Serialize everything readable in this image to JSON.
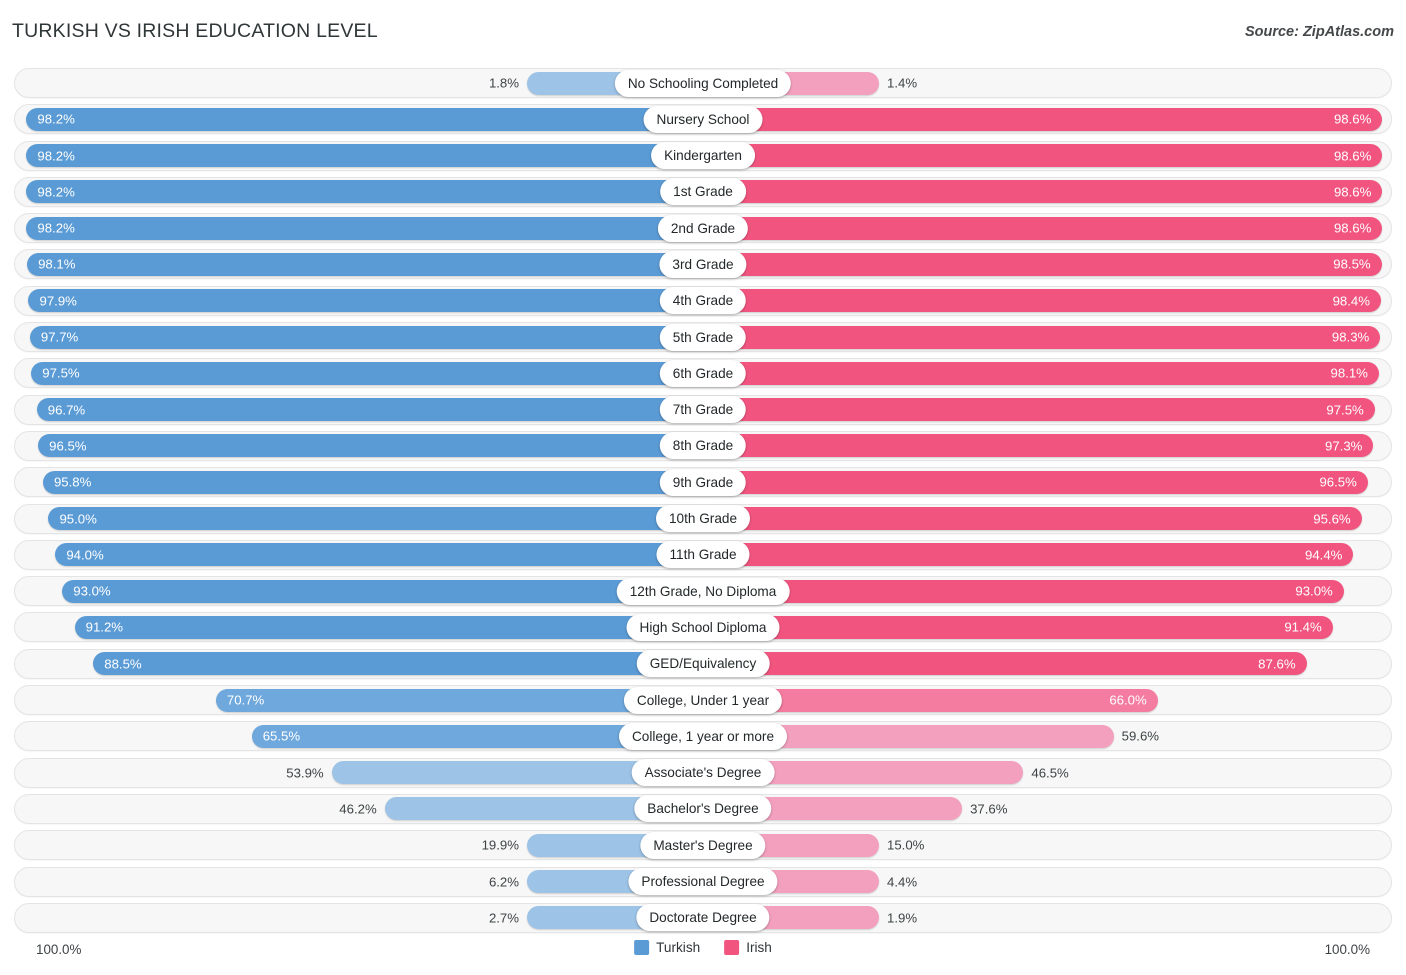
{
  "header": {
    "title": "TURKISH VS IRISH EDUCATION LEVEL",
    "source": "Source: ZipAtlas.com"
  },
  "footer": {
    "axis_left": "100.0%",
    "axis_right": "100.0%"
  },
  "legend": {
    "items": [
      {
        "label": "Turkish",
        "color": "#5B9BD5",
        "icon": "legend-swatch-turkish"
      },
      {
        "label": "Irish",
        "color": "#F1557F",
        "icon": "legend-swatch-irish"
      }
    ]
  },
  "colors": {
    "turkish_dark": "#5B9BD5",
    "turkish_mid": "#6FA8DC",
    "turkish_light": "#9DC3E6",
    "irish_dark": "#F1557F",
    "irish_mid": "#F47CA0",
    "irish_light": "#F2A0BE",
    "track": "#F7F7F7",
    "track_border": "#E4E4E4"
  },
  "chart_data": {
    "type": "bar",
    "orientation": "horizontal",
    "style": "diverging-bidirectional",
    "title": "TURKISH VS IRISH EDUCATION LEVEL",
    "xlabel": "",
    "ylabel": "",
    "xlim": [
      0,
      100
    ],
    "axis_left_max": "100.0%",
    "axis_right_max": "100.0%",
    "grid": false,
    "legend_position": "bottom-center",
    "categories": [
      "No Schooling Completed",
      "Nursery School",
      "Kindergarten",
      "1st Grade",
      "2nd Grade",
      "3rd Grade",
      "4th Grade",
      "5th Grade",
      "6th Grade",
      "7th Grade",
      "8th Grade",
      "9th Grade",
      "10th Grade",
      "11th Grade",
      "12th Grade, No Diploma",
      "High School Diploma",
      "GED/Equivalency",
      "College, Under 1 year",
      "College, 1 year or more",
      "Associate's Degree",
      "Bachelor's Degree",
      "Master's Degree",
      "Professional Degree",
      "Doctorate Degree"
    ],
    "series": [
      {
        "name": "Turkish",
        "side": "left",
        "color": "#5B9BD5",
        "values": [
          1.8,
          98.2,
          98.2,
          98.2,
          98.2,
          98.1,
          97.9,
          97.7,
          97.5,
          96.7,
          96.5,
          95.8,
          95.0,
          94.0,
          93.0,
          91.2,
          88.5,
          70.7,
          65.5,
          53.9,
          46.2,
          19.9,
          6.2,
          2.7
        ],
        "labels": [
          "1.8%",
          "98.2%",
          "98.2%",
          "98.2%",
          "98.2%",
          "98.1%",
          "97.9%",
          "97.7%",
          "97.5%",
          "96.7%",
          "96.5%",
          "95.8%",
          "95.0%",
          "94.0%",
          "93.0%",
          "91.2%",
          "88.5%",
          "70.7%",
          "65.5%",
          "53.9%",
          "46.2%",
          "19.9%",
          "6.2%",
          "2.7%"
        ]
      },
      {
        "name": "Irish",
        "side": "right",
        "color": "#F1557F",
        "values": [
          1.4,
          98.6,
          98.6,
          98.6,
          98.6,
          98.5,
          98.4,
          98.3,
          98.1,
          97.5,
          97.3,
          96.5,
          95.6,
          94.4,
          93.0,
          91.4,
          87.6,
          66.0,
          59.6,
          46.5,
          37.6,
          15.0,
          4.4,
          1.9
        ],
        "labels": [
          "1.4%",
          "98.6%",
          "98.6%",
          "98.6%",
          "98.6%",
          "98.5%",
          "98.4%",
          "98.3%",
          "98.1%",
          "97.5%",
          "97.3%",
          "96.5%",
          "95.6%",
          "94.4%",
          "93.0%",
          "91.4%",
          "87.6%",
          "66.0%",
          "59.6%",
          "46.5%",
          "37.6%",
          "15.0%",
          "4.4%",
          "1.9%"
        ]
      }
    ]
  }
}
